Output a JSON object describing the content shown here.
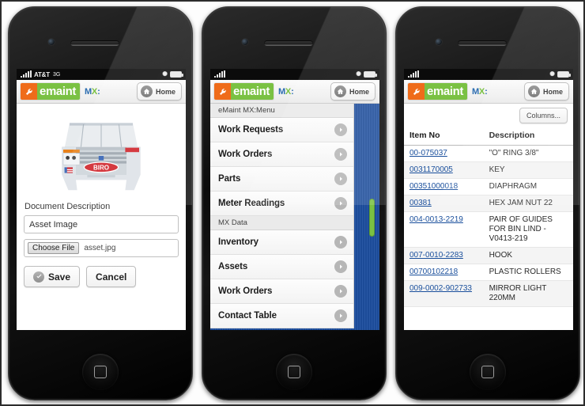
{
  "brand": {
    "logo_word": "emaint",
    "product_prefix": "MX",
    "product_suffix": ":",
    "home_label": "Home",
    "orange": "#ef6c1a",
    "green": "#7ac143",
    "blue": "#2b6cb0"
  },
  "phones": [
    {
      "name": "document-upload-screen",
      "status": {
        "carrier": "AT&T",
        "network": "3G"
      },
      "form": {
        "image_alt": "Asset Image",
        "description_label": "Document Description",
        "description_value": "Asset Image",
        "description_placeholder": "Document Description",
        "choose_file_label": "Choose File",
        "file_name": "asset.jpg",
        "save_label": "Save",
        "cancel_label": "Cancel"
      }
    },
    {
      "name": "menu-screen",
      "status": {
        "carrier": "",
        "network": ""
      },
      "menu": {
        "sections": [
          {
            "header": "eMaint MX:Menu",
            "items": [
              "Work Requests",
              "Work Orders",
              "Parts",
              "Meter Readings"
            ]
          },
          {
            "header": "MX Data",
            "items": [
              "Inventory",
              "Assets",
              "Work Orders",
              "Contact Table"
            ]
          }
        ]
      }
    },
    {
      "name": "inventory-table-screen",
      "status": {
        "carrier": "",
        "network": ""
      },
      "table": {
        "columns_button": "Columns...",
        "headers": [
          "Item No",
          "Description"
        ],
        "rows": [
          {
            "item_no": "00-075037",
            "description": "\"O\" RING 3/8\""
          },
          {
            "item_no": "0031170005",
            "description": "KEY"
          },
          {
            "item_no": "00351000018",
            "description": "DIAPHRAGM"
          },
          {
            "item_no": "00381",
            "description": "HEX JAM NUT 22"
          },
          {
            "item_no": "004-0013-2219",
            "description": "PAIR OF GUIDES FOR BIN LIND - V0413-219"
          },
          {
            "item_no": "007-0010-2283",
            "description": "HOOK"
          },
          {
            "item_no": "00700102218",
            "description": "PLASTIC ROLLERS"
          },
          {
            "item_no": "009-0002-902733",
            "description": "MIRROR LIGHT 220MM"
          }
        ]
      }
    }
  ]
}
